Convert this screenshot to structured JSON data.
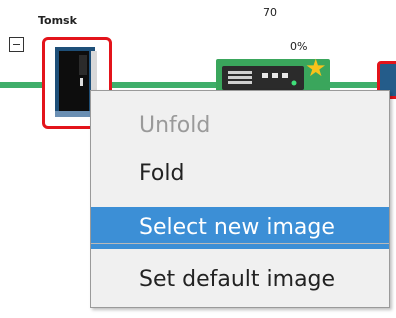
{
  "topology": {
    "node_label": "Tomsk",
    "top_number": "70",
    "percent": "0%",
    "link_color": "#3fae6a",
    "selection_color": "#e3141b"
  },
  "icons": {
    "collapse": "minus-box-icon",
    "rack": "server-rack-icon",
    "router": "network-switch-icon",
    "favorite": "star-icon"
  },
  "context_menu": {
    "items": [
      {
        "label": "Unfold",
        "state": "disabled"
      },
      {
        "label": "Fold",
        "state": "normal"
      },
      {
        "label": "Select new image",
        "state": "highlighted"
      },
      {
        "label": "Set default image",
        "state": "normal"
      }
    ],
    "highlight_color": "#3c8fd6"
  }
}
